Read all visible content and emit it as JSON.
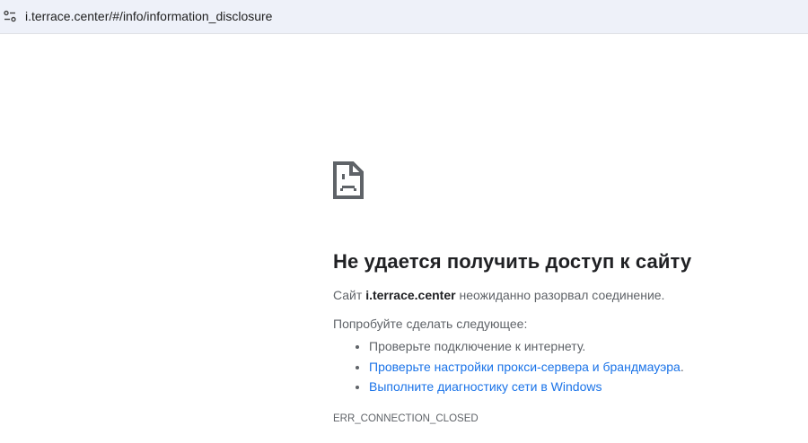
{
  "address_bar": {
    "url": "i.terrace.center/#/info/information_disclosure",
    "icon": "site-info-tune-icon"
  },
  "error": {
    "icon": "sad-page-icon",
    "title": "Не удается получить доступ к сайту",
    "message_prefix": "Сайт ",
    "host": "i.terrace.center",
    "message_suffix": " неожиданно разорвал соединение.",
    "try_label": "Попробуйте сделать следующее:",
    "suggestions": [
      {
        "text": "Проверьте подключение к интернету."
      },
      {
        "text": "Проверьте настройки прокси-сервера и брандмауэра",
        "suffix": "."
      },
      {
        "text": "Выполните диагностику сети в Windows"
      }
    ],
    "code": "ERR_CONNECTION_CLOSED"
  }
}
